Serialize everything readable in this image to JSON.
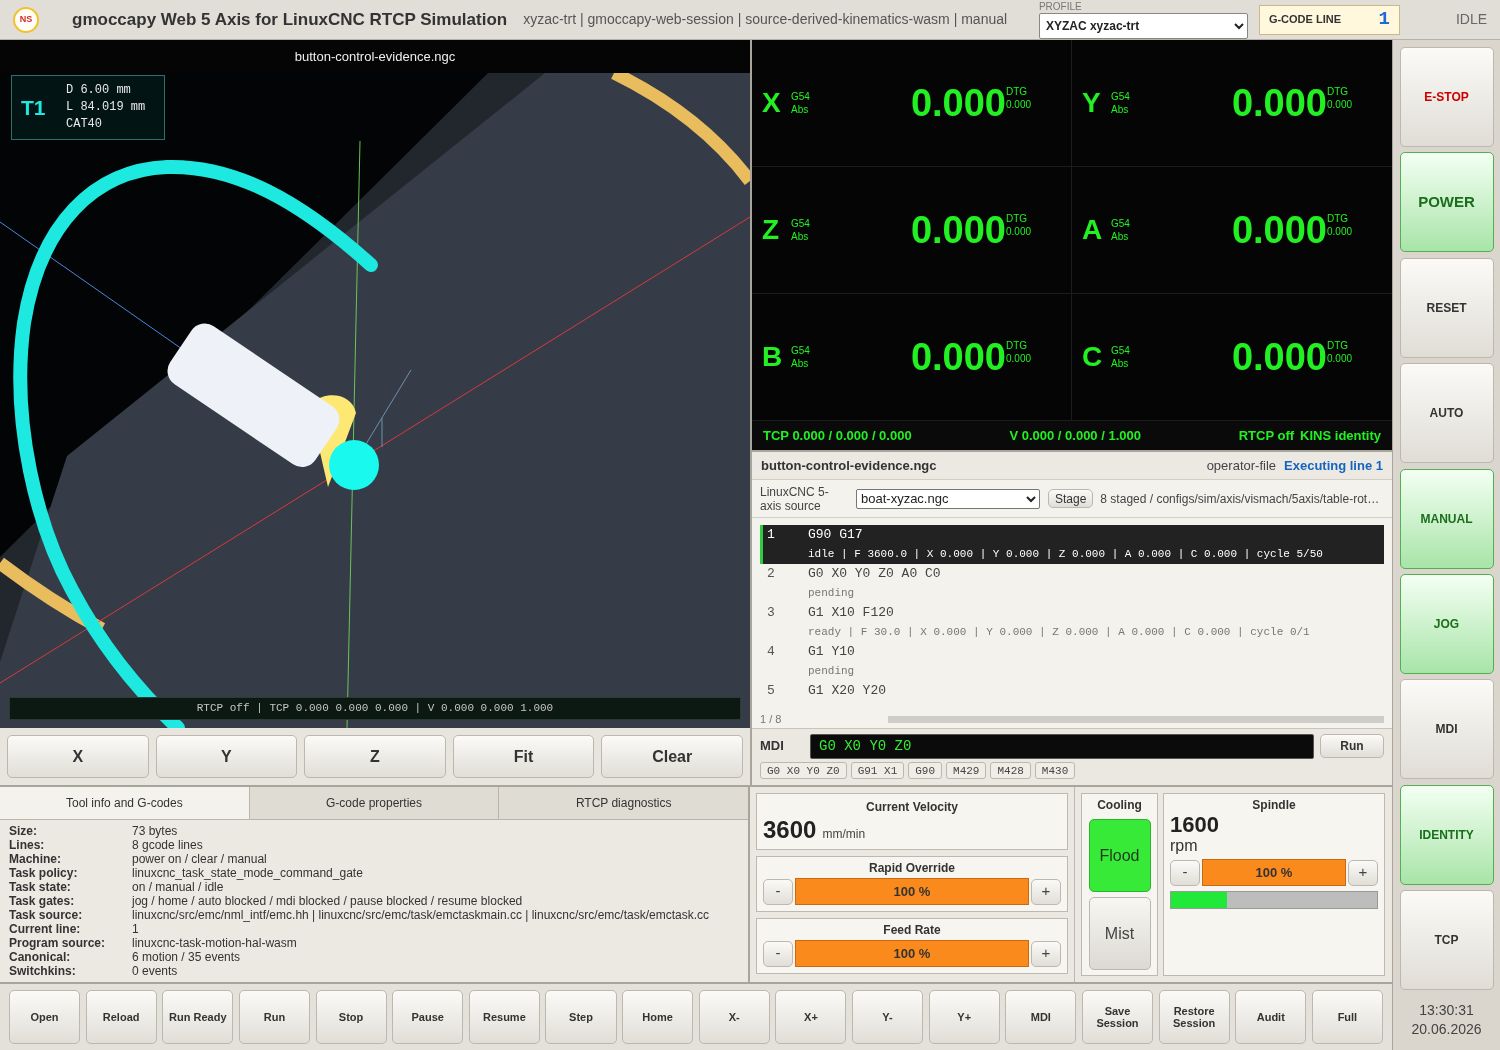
{
  "header": {
    "logo": "NS",
    "title": "gmoccapy Web 5 Axis for LinuxCNC RTCP Simulation",
    "subtitle": "xyzac-trt | gmoccapy-web-session | source-derived-kinematics-wasm | manual",
    "profile": {
      "label": "PROFILE",
      "value": "XYZAC xyzac-trt"
    },
    "gcode_line": {
      "label": "G-CODE LINE",
      "value": "1"
    },
    "state": "IDLE"
  },
  "viewport": {
    "title": "button-control-evidence.ngc",
    "tool": {
      "number": "T1",
      "details": [
        "D 6.00 mm",
        "L 84.019 mm",
        "CAT40"
      ]
    },
    "status": "RTCP off | TCP 0.000 0.000 0.000 | V 0.000 0.000 1.000",
    "view_buttons": [
      "X",
      "Y",
      "Z",
      "Fit",
      "Clear"
    ]
  },
  "dro": {
    "axes": [
      {
        "letter": "X",
        "offset": "G54",
        "mode": "Abs",
        "value": "0.000",
        "dtg_label": "DTG",
        "dtg": "0.000"
      },
      {
        "letter": "Y",
        "offset": "G54",
        "mode": "Abs",
        "value": "0.000",
        "dtg_label": "DTG",
        "dtg": "0.000"
      },
      {
        "letter": "Z",
        "offset": "G54",
        "mode": "Abs",
        "value": "0.000",
        "dtg_label": "DTG",
        "dtg": "0.000"
      },
      {
        "letter": "A",
        "offset": "G54",
        "mode": "Abs",
        "value": "0.000",
        "dtg_label": "DTG",
        "dtg": "0.000"
      },
      {
        "letter": "B",
        "offset": "G54",
        "mode": "Abs",
        "value": "0.000",
        "dtg_label": "DTG",
        "dtg": "0.000"
      },
      {
        "letter": "C",
        "offset": "G54",
        "mode": "Abs",
        "value": "0.000",
        "dtg_label": "DTG",
        "dtg": "0.000"
      }
    ],
    "footer": {
      "tcp": "TCP 0.000 / 0.000 / 0.000",
      "velocity": "V 0.000 / 0.000 / 1.000",
      "rtcp": "RTCP off",
      "kins": "KINS identity"
    }
  },
  "program": {
    "file": "button-control-evidence.ngc",
    "origin": "operator-file",
    "execution": "Executing line 1",
    "source": {
      "label": "LinuxCNC 5-axis source",
      "value": "boat-xyzac.ngc",
      "stage": "Stage",
      "info": "8 staged / configs/sim/axis/vismach/5axis/table-rot…"
    },
    "lines": [
      {
        "number": "1",
        "code": "G90 G17",
        "status": "idle | F 3600.0 | X 0.000 | Y 0.000 | Z 0.000 | A 0.000 | C 0.000 | cycle 5/50",
        "selected": true
      },
      {
        "number": "2",
        "code": "G0 X0 Y0 Z0 A0 C0",
        "status": "pending",
        "selected": false
      },
      {
        "number": "3",
        "code": "G1 X10 F120",
        "status": "ready | F 30.0 | X 0.000 | Y 0.000 | Z 0.000 | A 0.000 | C 0.000 | cycle 0/1",
        "selected": false
      },
      {
        "number": "4",
        "code": "G1 Y10",
        "status": "pending",
        "selected": false
      },
      {
        "number": "5",
        "code": "G1 X20 Y20",
        "selected": false
      }
    ],
    "position": "1 / 8"
  },
  "mdi": {
    "label": "MDI",
    "value": "G0 X0 Y0 Z0",
    "run": "Run",
    "history": [
      "G0 X0 Y0 Z0",
      "G91 X1",
      "G90",
      "M429",
      "M428",
      "M430"
    ]
  },
  "info_tabs": {
    "tabs": [
      {
        "label": "Tool info and G-codes",
        "selected": true
      },
      {
        "label": "G-code properties",
        "selected": false
      },
      {
        "label": "RTCP diagnostics",
        "selected": false
      }
    ],
    "rows": [
      {
        "label": "Size:",
        "value": "73 bytes"
      },
      {
        "label": "Lines:",
        "value": "8 gcode lines"
      },
      {
        "label": "Machine:",
        "value": "power on / clear / manual"
      },
      {
        "label": "Task policy:",
        "value": "linuxcnc_task_state_mode_command_gate"
      },
      {
        "label": "Task state:",
        "value": "on / manual / idle"
      },
      {
        "label": "Task gates:",
        "value": "jog / home / auto blocked / mdi blocked / pause blocked / resume blocked"
      },
      {
        "label": "Task source:",
        "value": "linuxcnc/src/emc/nml_intf/emc.hh | linuxcnc/src/emc/task/emctaskmain.cc | linuxcnc/src/emc/task/emctask.cc"
      },
      {
        "label": "Current line:",
        "value": "1"
      },
      {
        "label": "Program source:",
        "value": "linuxcnc-task-motion-hal-wasm"
      },
      {
        "label": "Canonical:",
        "value": "6 motion / 35 events"
      },
      {
        "label": "Switchkins:",
        "value": "0 events"
      }
    ]
  },
  "velocity": {
    "title": "Current Velocity",
    "value": "3600",
    "unit": "mm/min"
  },
  "overrides": [
    {
      "title": "Rapid Override",
      "minus": "-",
      "value": "100 %",
      "plus": "+"
    },
    {
      "title": "Feed Rate",
      "minus": "-",
      "value": "100 %",
      "plus": "+"
    }
  ],
  "cooling": {
    "title": "Cooling",
    "options": [
      {
        "label": "Flood",
        "on": true
      },
      {
        "label": "Mist",
        "on": false
      }
    ]
  },
  "spindle": {
    "title": "Spindle",
    "speed": "1600",
    "unit": "rpm",
    "minus": "-",
    "override": "100 %",
    "plus": "+",
    "level": 0.27
  },
  "toolbar": [
    "Open",
    "Reload",
    "Run Ready",
    "Run",
    "Stop",
    "Pause",
    "Resume",
    "Step",
    "Home",
    "X-",
    "X+",
    "Y-",
    "Y+",
    "MDI",
    "Save Session",
    "Restore Session",
    "Audit",
    "Full"
  ],
  "sidebar": {
    "buttons": [
      {
        "label": "E-STOP",
        "kind": "estop",
        "active": false
      },
      {
        "label": "POWER",
        "kind": "power",
        "active": true
      },
      {
        "label": "RESET",
        "kind": "command",
        "active": false
      },
      {
        "label": "AUTO",
        "kind": "mode",
        "active": false
      },
      {
        "label": "MANUAL",
        "kind": "mode",
        "active": true
      },
      {
        "label": "JOG",
        "kind": "mode",
        "active": true
      },
      {
        "label": "MDI",
        "kind": "mode",
        "active": false
      },
      {
        "label": "IDENTITY",
        "kind": "mode",
        "active": true
      },
      {
        "label": "TCP",
        "kind": "mode",
        "active": false
      }
    ],
    "time": "13:30:31",
    "date": "20.06.2026"
  }
}
